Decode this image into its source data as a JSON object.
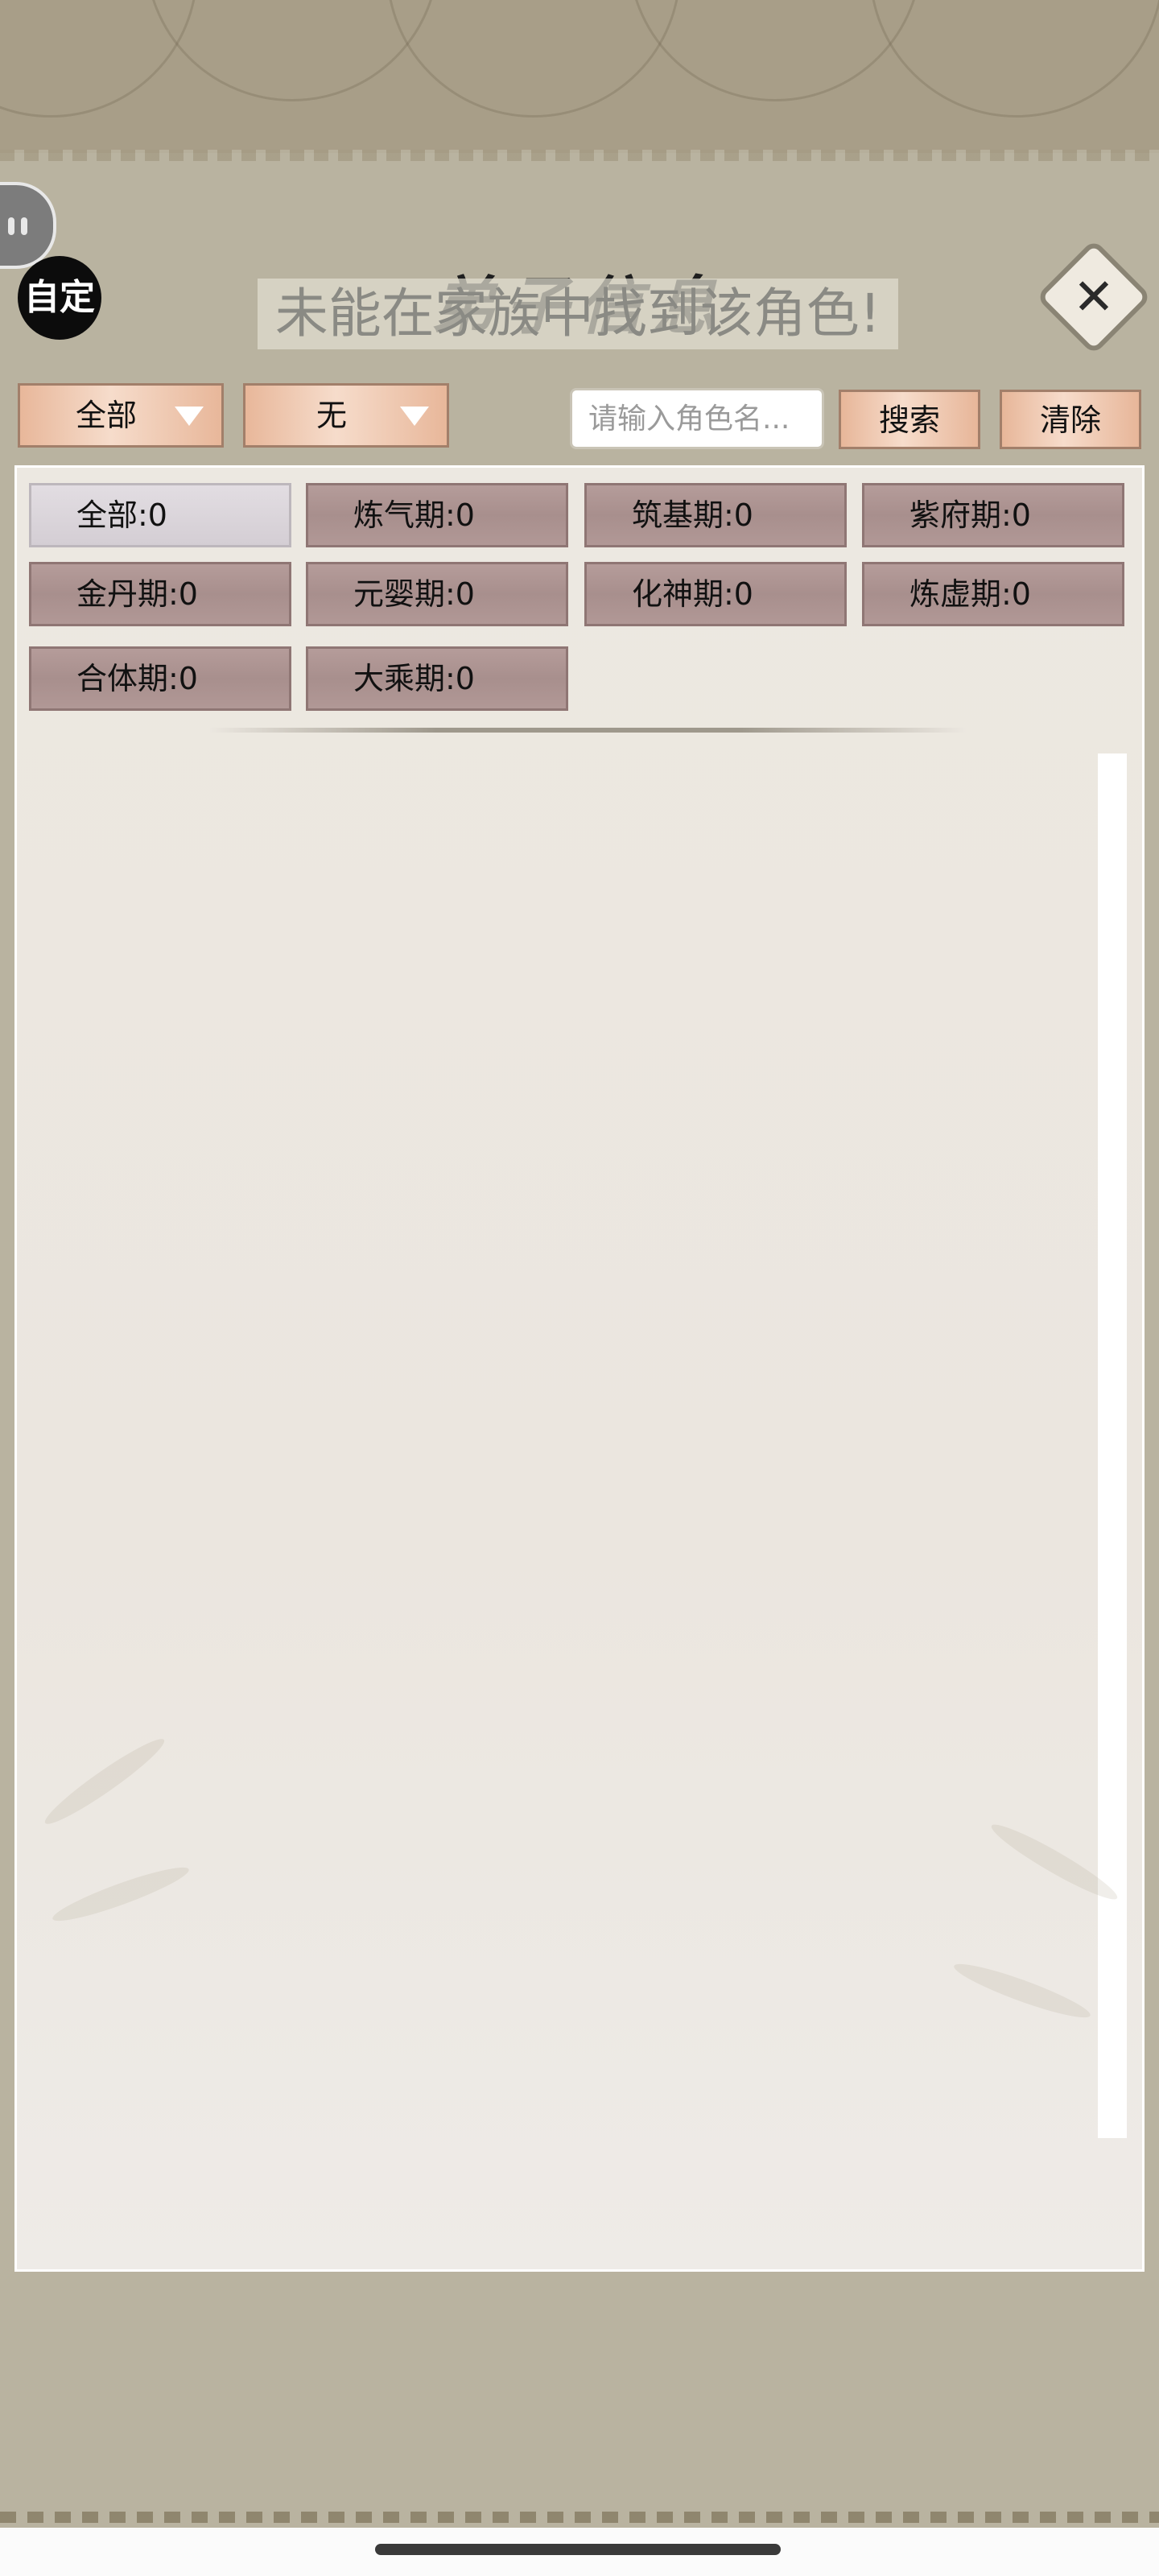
{
  "header": {
    "badge_label": "自定",
    "title": "弟子信息",
    "toast": "未能在家族中找到该角色!",
    "close_glyph": "✕"
  },
  "filters": {
    "dropdown1": "全部",
    "dropdown2": "无",
    "search_placeholder": "请输入角色名...",
    "search_button": "搜索",
    "clear_button": "清除"
  },
  "realms": [
    {
      "label": "全部:0"
    },
    {
      "label": "炼气期:0"
    },
    {
      "label": "筑基期:0"
    },
    {
      "label": "紫府期:0"
    },
    {
      "label": "金丹期:0"
    },
    {
      "label": "元婴期:0"
    },
    {
      "label": "化神期:0"
    },
    {
      "label": "炼虚期:0"
    },
    {
      "label": "合体期:0"
    },
    {
      "label": "大乘期:0"
    }
  ],
  "icons": {
    "float_button": "assistant-float-icon",
    "close": "close-icon",
    "dropdown_arrow": "triangle-down-icon"
  },
  "colors": {
    "panel": "#b9b3a0",
    "chip": "#a88f8d",
    "chip_active": "#d4ced4",
    "button": "#e7b699"
  }
}
